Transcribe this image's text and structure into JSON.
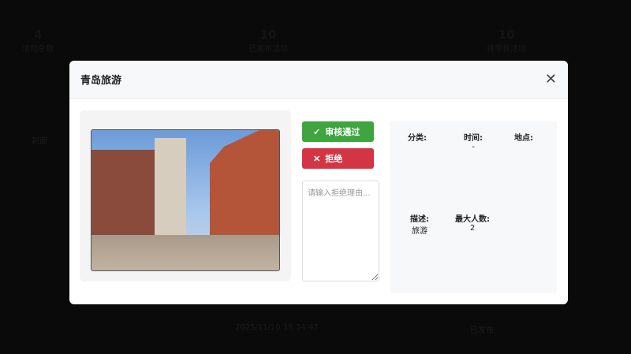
{
  "background": {
    "stats": [
      {
        "value": "4",
        "label": "活动总数"
      },
      {
        "value": "10",
        "label": "已发布活动"
      },
      {
        "value": "10",
        "label": "待审核活动"
      }
    ],
    "table_header_cover": "封面",
    "row_time": "2025/11/10 15:34:47",
    "row_status": "已发布"
  },
  "modal": {
    "title": "青岛旅游",
    "approve_label": "审核通过",
    "reject_label": "拒绝",
    "reason_placeholder": "请输入拒绝理由...",
    "fields": {
      "category_label": "分类:",
      "category_value": "",
      "time_label": "时间:",
      "time_value": "-",
      "location_label": "地点:",
      "location_value": "",
      "description_label": "描述:",
      "description_value": "旅游",
      "max_people_label": "最大人数:",
      "max_people_value": "2"
    }
  },
  "colors": {
    "approve": "#3fa53f",
    "reject": "#d33545"
  }
}
